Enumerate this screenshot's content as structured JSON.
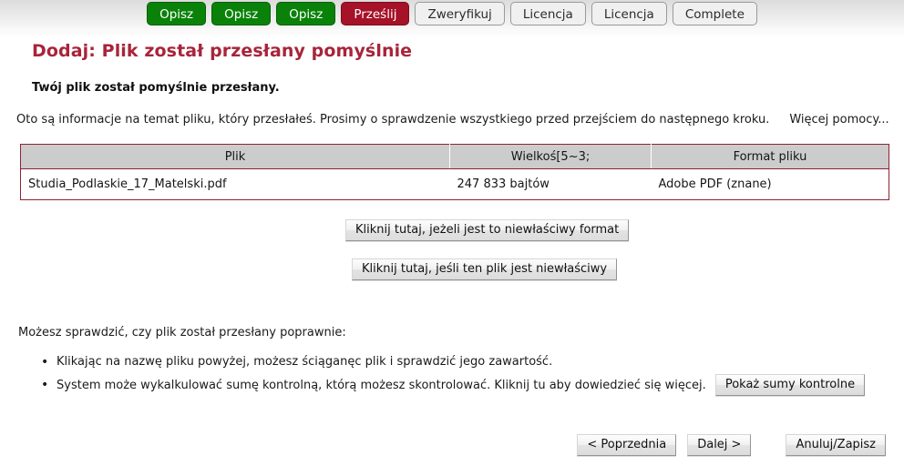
{
  "progress": {
    "steps": [
      {
        "label": "Opisz",
        "state": "done"
      },
      {
        "label": "Opisz",
        "state": "done"
      },
      {
        "label": "Opisz",
        "state": "done"
      },
      {
        "label": "Prześlij",
        "state": "current"
      },
      {
        "label": "Zweryfikuj",
        "state": "todo"
      },
      {
        "label": "Licencja",
        "state": "todo"
      },
      {
        "label": "Licencja",
        "state": "todo"
      },
      {
        "label": "Complete",
        "state": "todo"
      }
    ],
    "colors": {
      "done": "#0a820a",
      "current": "#a61228",
      "todo": "#f0f0f0"
    }
  },
  "header": {
    "title": "Dodaj: Plik został przesłany pomyślnie",
    "title_color": "#a8243a",
    "subtitle": "Twój plik został pomyślnie przesłany.",
    "intro": "Oto są informacje na temat pliku, który przesłałeś. Prosimy o sprawdzenie wszystkiego przed przejściem do następnego kroku.",
    "help_link": "Więcej pomocy..."
  },
  "file_table": {
    "columns": [
      "Plik",
      "Wielkoś[5~3;",
      "Format pliku"
    ],
    "rows": [
      {
        "name": "Studia_Podlaskie_17_Matelski.pdf",
        "size": "247 833 bajtów",
        "format": "Adobe PDF (znane)"
      }
    ],
    "border_color": "#8f2231",
    "header_bg": "#cccccc"
  },
  "actions": {
    "wrong_format": "Kliknij tutaj, jeżeli jest to niewłaściwy format",
    "wrong_file": "Kliknij tutaj, jeśli ten plik jest niewłaściwy"
  },
  "verification": {
    "lead": "Możesz sprawdzić, czy plik został przesłany poprawnie:",
    "bullets": [
      "Klikając na nazwę pliku powyżej, możesz ściąganęc plik i sprawdzić jego zawartość.",
      "System może wykalkulować sumę kontrolną, którą możesz skontrolować. Kliknij tu aby dowiedzieć się więcej."
    ],
    "checksums_button": "Pokaż sumy kontrolne"
  },
  "navigation": {
    "previous": "< Poprzednia",
    "next": "Dalej >",
    "cancel": "Anuluj/Zapisz"
  }
}
